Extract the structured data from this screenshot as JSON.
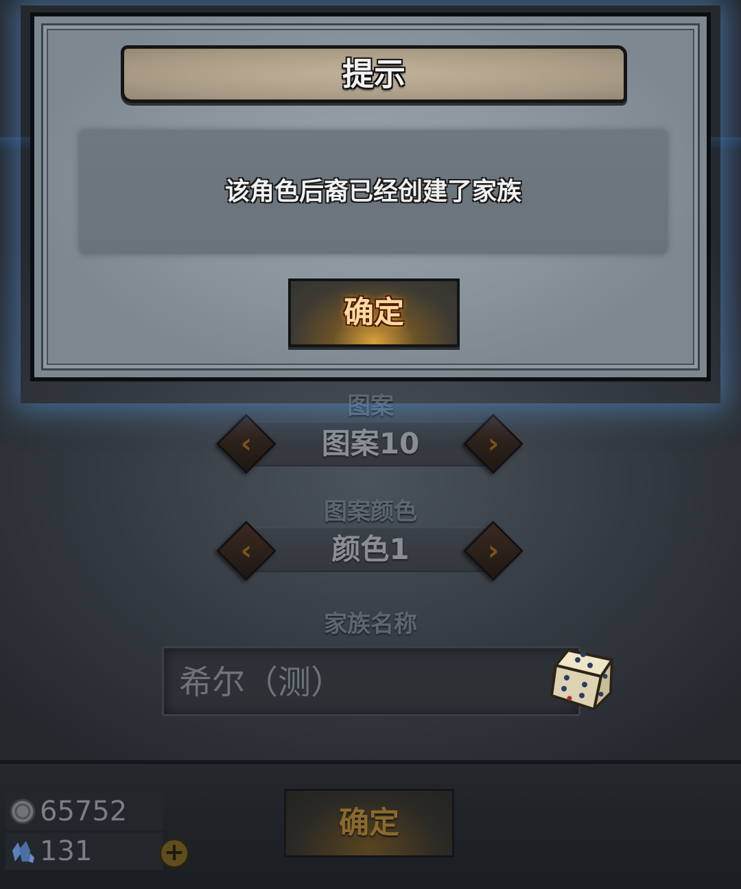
{
  "dialog": {
    "title": "提示",
    "message": "该角色后裔已经创建了家族",
    "confirm_label": "确定"
  },
  "form": {
    "pattern_label": "图案",
    "pattern_value": "图案10",
    "pattern_color_label": "图案颜色",
    "pattern_color_value": "颜色1",
    "family_name_label": "家族名称",
    "family_name_value": "希尔（测）"
  },
  "footer": {
    "silver_amount": "65752",
    "crystal_amount": "131",
    "confirm_label": "确定"
  },
  "icons": {
    "prev": "chevron-left-icon",
    "next": "chevron-right-icon",
    "random": "dice-icon",
    "silver": "silver-coin-icon",
    "crystal": "crystal-icon",
    "add": "plus-icon"
  },
  "colors": {
    "dialog_confirm_text": "#ffd9a0",
    "dialog_glow": "#5a96dc",
    "arrow_accent": "#7a5318"
  }
}
